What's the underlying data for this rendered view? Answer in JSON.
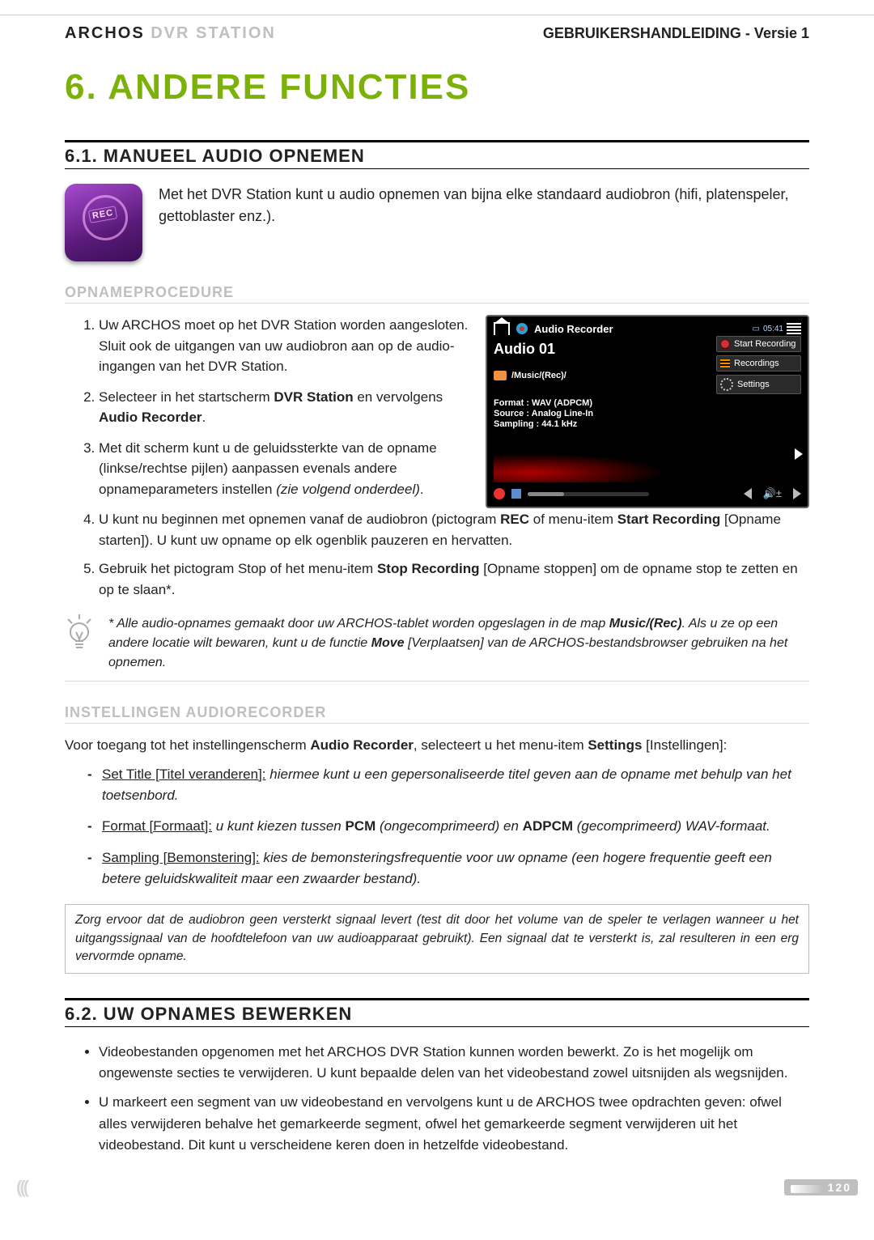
{
  "header": {
    "brand_main": "ARCHOS",
    "brand_sub": " DVR STATION",
    "manual": "GEBRUIKERSHANDLEIDING - Versie 1"
  },
  "chapter_title": "6. ANDERE FUNCTIES",
  "section61": {
    "heading": "6.1. MANUEEL AUDIO OPNEMEN",
    "intro": "Met het DVR Station kunt u audio opnemen van bijna elke standaard audiobron (hifi, platenspeler, gettoblaster enz.).",
    "sub_procedure": "OPNAMEPROCEDURE",
    "steps": {
      "s1": "Uw ARCHOS moet op het DVR Station worden aangesloten. Sluit ook de uitgangen van uw audiobron aan op de audio-ingangen van het DVR Station.",
      "s2_a": "Selecteer in het startscherm ",
      "s2_bold": "DVR Station",
      "s2_b": " en vervolgens ",
      "s2_bold2": "Audio Recorder",
      "s2_c": ".",
      "s3_a": "Met dit scherm kunt u de geluidssterkte van de opname (linkse/rechtse pijlen) aanpassen evenals andere opnameparameters instellen ",
      "s3_em": "(zie volgend onderdeel)",
      "s3_b": ".",
      "s4_a": "U kunt nu beginnen met opnemen vanaf de audiobron (pictogram ",
      "s4_bold1": "REC",
      "s4_b": " of menu-item ",
      "s4_bold2": "Start Recording",
      "s4_c": " [Opname starten]). U kunt uw opname op elk ogenblik pauzeren en hervatten.",
      "s5_a": "Gebruik het pictogram Stop of het menu-item ",
      "s5_bold": "Stop Recording",
      "s5_b": " [Opname stoppen] om de opname stop te zetten en op te slaan*."
    },
    "screenshot": {
      "top_title": "Audio Recorder",
      "time": "05:41",
      "audio_label": "Audio 01",
      "btn_start": "Start Recording",
      "btn_recordings": "Recordings",
      "btn_settings": "Settings",
      "path": "/Music/(Rec)/",
      "meta_format": "Format : WAV (ADPCM)",
      "meta_source": "Source : Analog Line-In",
      "meta_sampling": "Sampling : 44.1 kHz"
    },
    "tip_a": "* Alle audio-opnames gemaakt door uw ARCHOS-tablet worden opgeslagen in de map ",
    "tip_bold": "Music/(Rec)",
    "tip_b": ". Als u ze op een andere locatie wilt bewaren, kunt u de functie ",
    "tip_bold2": "Move",
    "tip_c": " [Verplaatsen] van de ARCHOS-bestandsbrowser gebruiken na het opnemen.",
    "sub_settings": "INSTELLINGEN AUDIORECORDER",
    "settings_intro_a": "Voor toegang tot het instellingenscherm ",
    "settings_intro_bold": "Audio Recorder",
    "settings_intro_b": ", selecteert u het menu-item ",
    "settings_intro_bold2": "Settings",
    "settings_intro_c": " [Instellingen]:",
    "setlist": {
      "i1_u": "Set Title [Titel veranderen]:",
      "i1_t": " hiermee kunt u een gepersonaliseerde titel geven aan de opname met behulp van het toetsenbord.",
      "i2_u": "Format [Formaat]:",
      "i2_a": " u kunt kiezen tussen ",
      "i2_b1": "PCM",
      "i2_b": " (ongecomprimeerd) en ",
      "i2_b2": "ADPCM",
      "i2_c": " (gecomprimeerd) WAV-formaat.",
      "i3_u": "Sampling [Bemonstering]:",
      "i3_t": " kies de bemonsteringsfrequentie voor uw opname (een hogere frequentie geeft een betere geluidskwaliteit maar een zwaarder bestand)."
    },
    "note": "Zorg ervoor dat de audiobron geen versterkt signaal levert (test dit door het volume van de speler te verlagen wanneer u het uitgangssignaal van de hoofdtelefoon van uw audioapparaat gebruikt). Een signaal dat te versterkt is, zal resulteren in een erg vervormde opname."
  },
  "section62": {
    "heading": "6.2. UW OPNAMES BEWERKEN",
    "b1": "Videobestanden opgenomen met het ARCHOS DVR Station kunnen worden bewerkt. Zo is het mogelijk om ongewenste secties te verwijderen. U kunt bepaalde delen van het videobestand zowel uitsnijden als wegsnijden.",
    "b2": "U markeert een segment van uw videobestand en vervolgens kunt u de ARCHOS twee opdrachten geven: ofwel alles verwijderen behalve het gemarkeerde segment, ofwel het gemarkeerde segment verwijderen uit het videobestand. Dit kunt u verscheidene keren doen in hetzelfde videobestand."
  },
  "footer": {
    "left": "(((",
    "page": "120"
  }
}
